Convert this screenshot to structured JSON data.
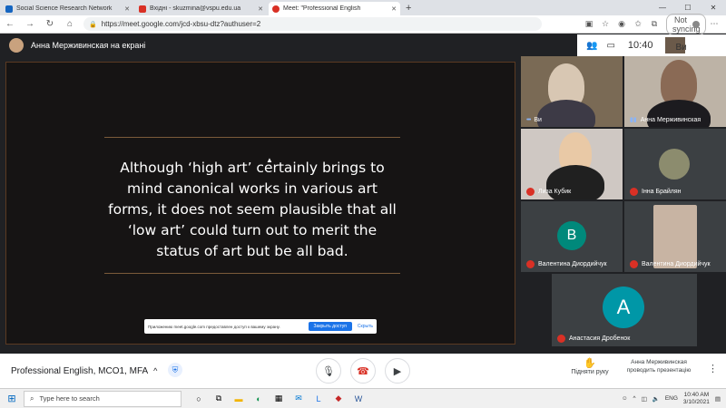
{
  "browser": {
    "tabs": [
      {
        "label": "Social Science Research Network",
        "icon": "ssrn-icon",
        "color": "#1565c0",
        "active": false
      },
      {
        "label": "Вхідні - skuzmina@vspu.edu.ua",
        "icon": "gmail-icon",
        "color": "#d93025",
        "active": false
      },
      {
        "label": "Meet: \"Professional English",
        "icon": "meet-icon",
        "color": "#d93025",
        "active": true
      }
    ],
    "url": "https://meet.google.com/jcd-xbsu-dtz?authuser=2",
    "sync_label": "Not syncing"
  },
  "meet": {
    "presenter_label": "Анна Мерживинская на екрані",
    "clock": "10:40",
    "thumb_label": "Ви",
    "slide": {
      "text": "Although ‘high art’ certainly brings to mind canonical works in various art forms, it does not seem plausible that all ‘low art’ could turn out to merit the status of art but be all bad."
    },
    "notice": {
      "text": "Приложению meet.google.com предоставлен доступ к вашему экрану.",
      "button": "Закрыть доступ",
      "link": "Скрыть"
    },
    "participants": [
      {
        "name": "Ви"
      },
      {
        "name": "Анна Мерживинская"
      },
      {
        "name": "Лиза Кубик"
      },
      {
        "name": "Інна Брайлян"
      },
      {
        "name": "Валентина Диордийчук",
        "initial": "В",
        "color": "#00897b"
      },
      {
        "name": "Валентина Диордийчук"
      },
      {
        "name": "Анастасия Дробенок",
        "initial": "А",
        "color": "#0097a7"
      }
    ],
    "meeting_title": "Professional English, MCO1, MFA",
    "raise_hand": "Підняти руку",
    "presenting": "Анна Мерживинская проводить презентацію"
  },
  "taskbar": {
    "search_placeholder": "Type here to search",
    "lang": "ENG",
    "time": "10:40 AM",
    "date": "3/10/2021"
  }
}
